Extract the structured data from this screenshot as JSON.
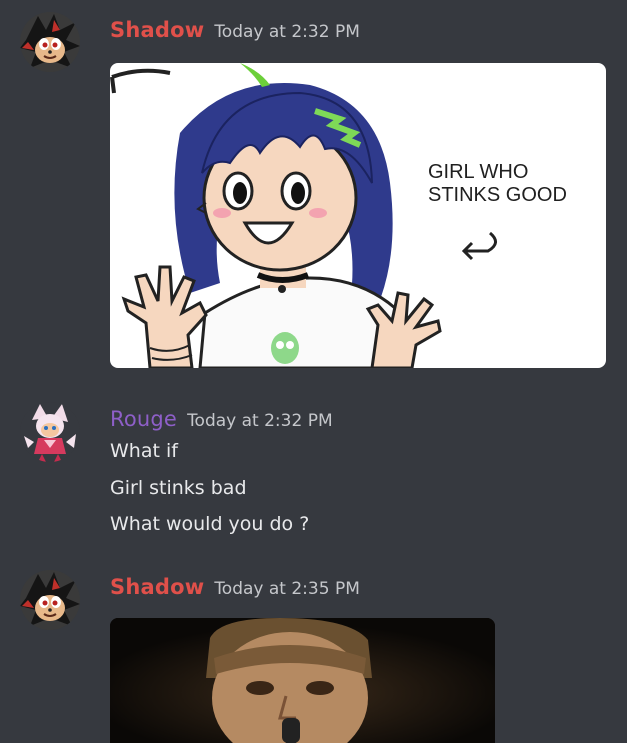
{
  "messages": [
    {
      "author": "Shadow",
      "author_color": "#e0504a",
      "timestamp": "Today at 2:32 PM",
      "avatar_icon": "shadow-hedgehog-avatar",
      "attachment": {
        "kind": "drawing",
        "caption_lines": [
          "GIRL WHO",
          "STINKS GOOD"
        ],
        "arrow_icon": "curved-arrow-icon"
      }
    },
    {
      "author": "Rouge",
      "author_color": "#8e5fc8",
      "timestamp": "Today at 2:32 PM",
      "avatar_icon": "rouge-bat-avatar",
      "lines": [
        "What if",
        "Girl stinks bad",
        "What would you do ?"
      ]
    },
    {
      "author": "Shadow",
      "author_color": "#e0504a",
      "timestamp": "Today at 2:35 PM",
      "avatar_icon": "shadow-hedgehog-avatar",
      "attachment": {
        "kind": "photo"
      }
    }
  ]
}
